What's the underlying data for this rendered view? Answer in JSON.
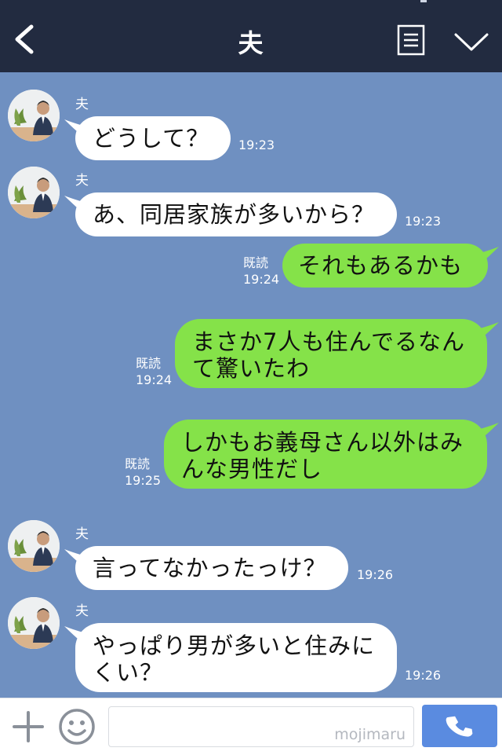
{
  "header": {
    "title": "夫",
    "back_icon": "chevron-left-icon",
    "menu_icon": "list-icon",
    "collapse_icon": "chevron-down-icon"
  },
  "messages": [
    {
      "from": "夫",
      "side": "in",
      "lines": [
        "どうして？"
      ],
      "time": "19:23"
    },
    {
      "from": "夫",
      "side": "in",
      "lines": [
        "あ、同居家族が多いから？"
      ],
      "time": "19:23"
    },
    {
      "side": "out",
      "lines": [
        "それもあるかも"
      ],
      "read": "既読",
      "time": "19:24"
    },
    {
      "side": "out",
      "lines": [
        "まさか7人も住んでるなん",
        "て驚いたわ"
      ],
      "read": "既読",
      "time": "19:24"
    },
    {
      "side": "out",
      "lines": [
        "しかもお義母さん以外はみ",
        "んな男性だし"
      ],
      "read": "既読",
      "time": "19:25"
    },
    {
      "from": "夫",
      "side": "in",
      "lines": [
        "言ってなかったっけ？"
      ],
      "time": "19:26"
    },
    {
      "from": "夫",
      "side": "in",
      "lines": [
        "やっぱり男が多いと住みに",
        "くい？"
      ],
      "time": "19:26"
    }
  ],
  "footer": {
    "input_value": "",
    "watermark": "mojimaru",
    "plus_icon": "plus-icon",
    "emoji_icon": "smiley-icon",
    "send_icon": "phone-icon"
  },
  "colors": {
    "header_bg": "#222b40",
    "chat_bg": "#6f90c1",
    "incoming_bubble": "#ffffff",
    "outgoing_bubble": "#85e249",
    "send_button": "#5a8be0"
  }
}
